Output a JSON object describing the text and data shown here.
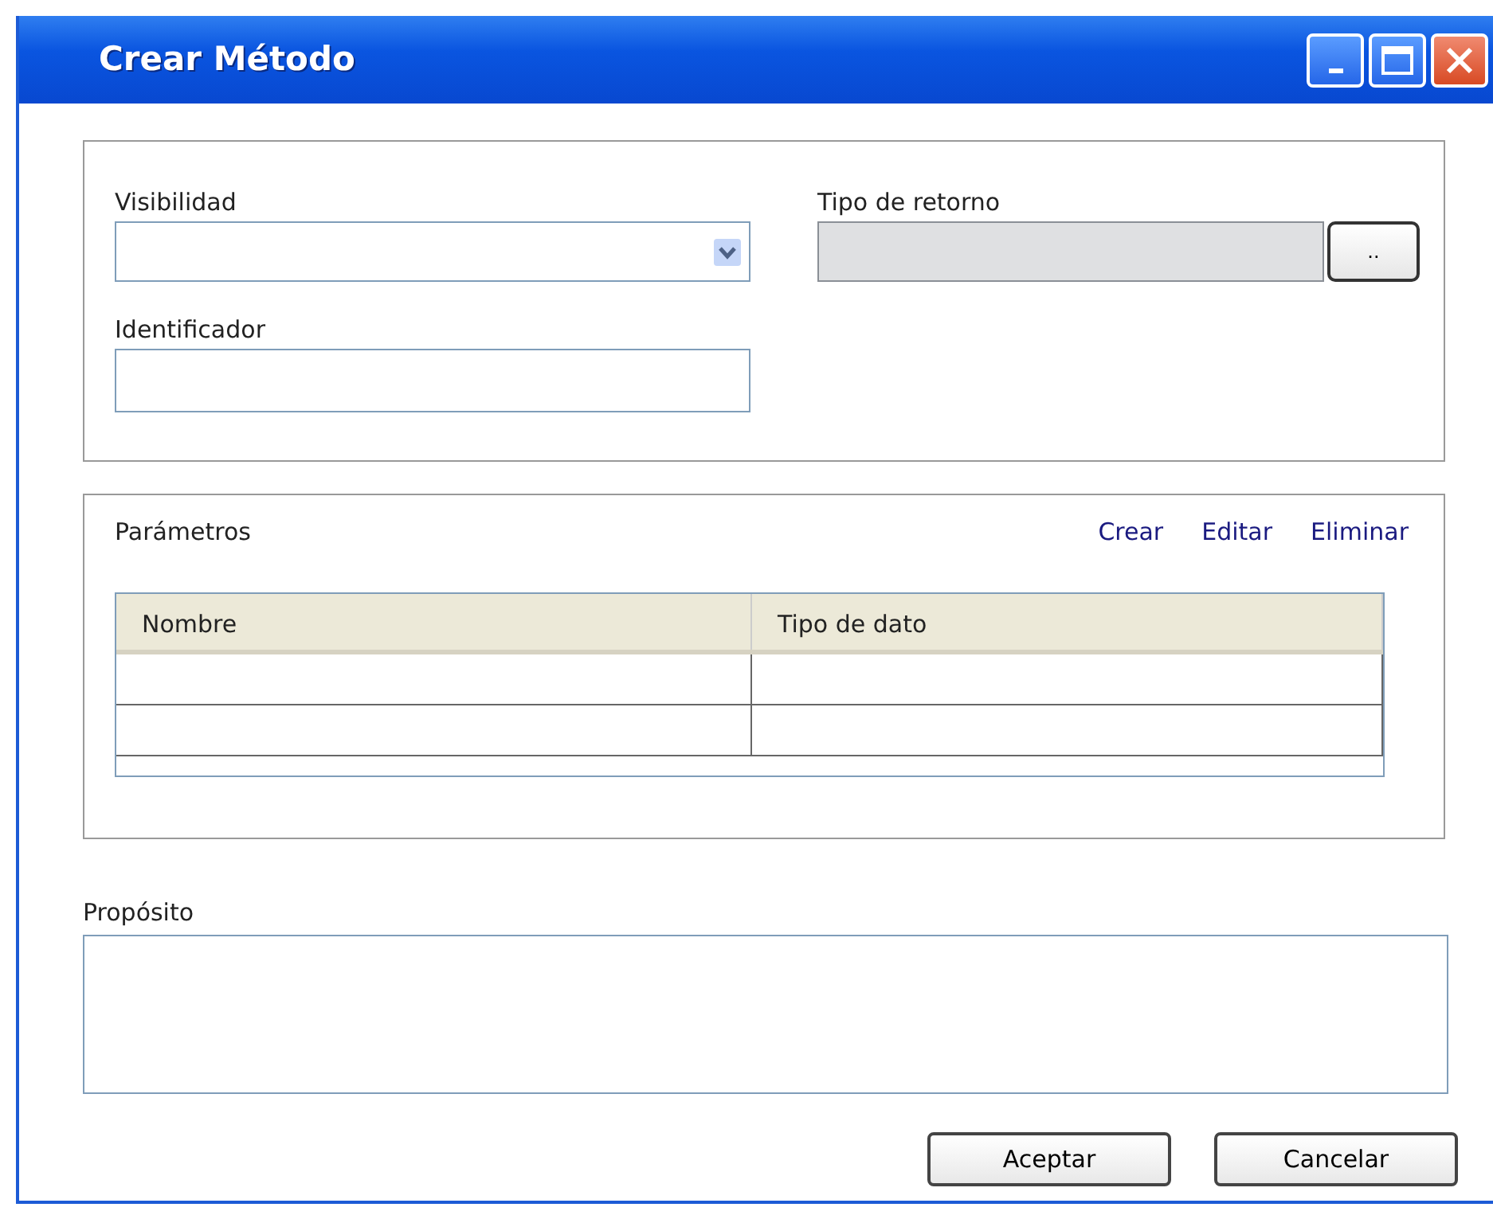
{
  "window": {
    "title": "Crear Método"
  },
  "general": {
    "visibility": {
      "label": "Visibilidad"
    },
    "identifier": {
      "label": "Identificador"
    },
    "return_type": {
      "label": "Tipo de retorno",
      "disabled": true,
      "browse_button": ".."
    }
  },
  "parameters": {
    "title": "Parámetros",
    "actions": [
      "Crear",
      "Editar",
      "Eliminar"
    ],
    "columns": [
      "Nombre",
      "Tipo de dato"
    ]
  },
  "purpose": {
    "label": "Propósito"
  },
  "buttons": [
    "Aceptar",
    "Cancelar"
  ]
}
